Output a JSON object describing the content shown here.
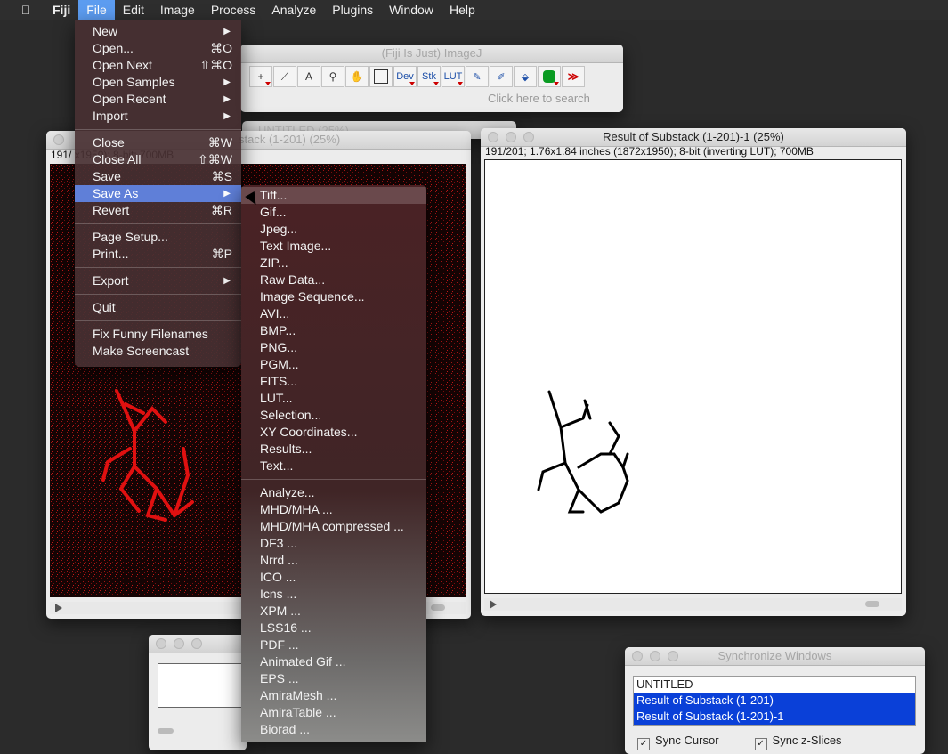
{
  "menubar": {
    "items": [
      "Fiji",
      "File",
      "Edit",
      "Image",
      "Process",
      "Analyze",
      "Plugins",
      "Window",
      "Help"
    ]
  },
  "imagej": {
    "title": "(Fiji Is Just) ImageJ",
    "search_placeholder": "Click here to search",
    "tools": [
      "rect",
      "line",
      "A",
      "zoom",
      "hand",
      "color",
      "Dev",
      "Stk",
      "LUT",
      "pencil",
      "brush",
      "bucket",
      "octagon",
      ">>"
    ]
  },
  "untitled_window": {
    "title": "UNTITLED (25%)"
  },
  "left_window": {
    "title": "stack (1-201) (25%)",
    "info": "191/                    x1950); 8-bit; 700MB"
  },
  "right_window": {
    "title": "Result of Substack (1-201)-1 (25%)",
    "info": "191/201; 1.76x1.84 inches (1872x1950); 8-bit (inverting LUT); 700MB"
  },
  "sync_window": {
    "title": "Synchronize Windows",
    "items": [
      "UNTITLED",
      "Result of Substack (1-201)",
      "Result of Substack (1-201)-1"
    ],
    "check1": "Sync Cursor",
    "check2": "Sync z-Slices"
  },
  "file_menu": {
    "new": "New",
    "open": "Open...",
    "open_sc": "⌘O",
    "open_next": "Open Next",
    "open_next_sc": "⇧⌘O",
    "open_samples": "Open Samples",
    "open_recent": "Open Recent",
    "import": "Import",
    "close": "Close",
    "close_sc": "⌘W",
    "close_all": "Close All",
    "close_all_sc": "⇧⌘W",
    "save": "Save",
    "save_sc": "⌘S",
    "save_as": "Save As",
    "revert": "Revert",
    "revert_sc": "⌘R",
    "page_setup": "Page Setup...",
    "print": "Print...",
    "print_sc": "⌘P",
    "export": "Export",
    "quit": "Quit",
    "fix": "Fix Funny Filenames",
    "screencast": "Make Screencast"
  },
  "save_as_menu": {
    "group1": [
      "Tiff...",
      "Gif...",
      "Jpeg...",
      "Text Image...",
      "ZIP...",
      "Raw Data...",
      "Image Sequence...",
      "AVI...",
      "BMP...",
      "PNG...",
      "PGM...",
      "FITS...",
      "LUT...",
      "Selection...",
      "XY Coordinates...",
      "Results...",
      "Text..."
    ],
    "group2": [
      "Analyze...",
      "MHD/MHA ...",
      "MHD/MHA compressed ...",
      "DF3 ...",
      "Nrrd ...",
      "ICO ...",
      "Icns ...",
      "XPM ...",
      "LSS16 ...",
      "PDF ...",
      "Animated Gif ...",
      "EPS ...",
      "AmiraMesh ...",
      "AmiraTable ...",
      "Biorad ..."
    ]
  }
}
